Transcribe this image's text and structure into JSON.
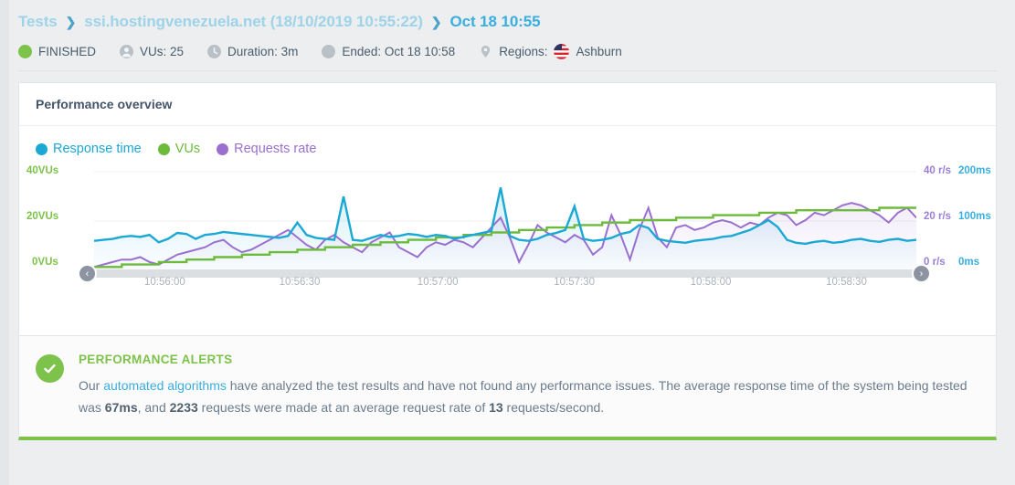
{
  "breadcrumb": {
    "root": "Tests",
    "separator": "❯",
    "test_name": "ssi.hostingvenezuela.net (18/10/2019 10:55:22)",
    "current": "Oct 18 10:55"
  },
  "meta": {
    "status": "FINISHED",
    "status_color": "#7dc24b",
    "vus": "VUs: 25",
    "duration": "Duration: 3m",
    "ended": "Ended: Oct 18 10:58",
    "regions_label": "Regions:",
    "region": "Ashburn",
    "icons": {
      "status": "circle-filled-icon",
      "vus": "user-icon",
      "duration": "clock-icon",
      "ended": "circle-icon",
      "regions": "map-pin-icon",
      "flag": "us-flag-icon"
    }
  },
  "overview": {
    "title": "Performance overview"
  },
  "chart_data": {
    "type": "line",
    "title": "Performance overview",
    "xlabel": "",
    "grid": true,
    "legend_position": "top-left",
    "x_ticks": [
      "10:56:00",
      "10:56:30",
      "10:57:00",
      "10:57:30",
      "10:58:00",
      "10:58:30"
    ],
    "x_tick_positions_pct": [
      8.6,
      25.0,
      41.8,
      58.4,
      75.0,
      91.5
    ],
    "axes": {
      "left": {
        "name": "VUs",
        "color": "#7dc24b",
        "ticks": [
          "0VUs",
          "20VUs",
          "40VUs"
        ],
        "range": [
          0,
          40
        ]
      },
      "right_inner": {
        "name": "Requests rate",
        "color": "#9b7fd4",
        "ticks": [
          "0 r/s",
          "20 r/s",
          "40 r/s"
        ],
        "range": [
          0,
          40
        ]
      },
      "right_outer": {
        "name": "Response time",
        "color": "#3aaede",
        "ticks": [
          "0ms",
          "100ms",
          "200ms"
        ],
        "range": [
          0,
          200
        ]
      }
    },
    "series": [
      {
        "name": "Response time",
        "color": "#1ba8d4",
        "unit": "ms",
        "axis": "right_outer",
        "filled": true,
        "values": [
          58,
          60,
          62,
          66,
          68,
          66,
          70,
          55,
          62,
          74,
          72,
          62,
          70,
          72,
          76,
          74,
          72,
          70,
          68,
          66,
          64,
          68,
          95,
          70,
          64,
          62,
          60,
          148,
          60,
          58,
          64,
          70,
          66,
          68,
          72,
          70,
          66,
          70,
          68,
          62,
          66,
          70,
          74,
          78,
          166,
          68,
          60,
          58,
          62,
          70,
          74,
          80,
          128,
          62,
          58,
          60,
          64,
          72,
          76,
          90,
          84,
          62,
          58,
          56,
          54,
          58,
          60,
          62,
          66,
          68,
          74,
          80,
          90,
          100,
          86,
          60,
          54,
          52,
          56,
          58,
          54,
          56,
          60,
          62,
          58,
          56,
          60,
          62,
          58,
          60
        ]
      },
      {
        "name": "VUs",
        "color": "#6cbb3c",
        "unit": "VUs",
        "axis": "left",
        "step": true,
        "values": [
          1,
          1,
          1,
          2,
          2,
          2,
          2,
          3,
          3,
          3,
          4,
          4,
          4,
          5,
          5,
          5,
          6,
          6,
          6,
          7,
          7,
          7,
          8,
          8,
          8,
          9,
          9,
          9,
          10,
          10,
          10,
          11,
          11,
          11,
          12,
          12,
          12,
          13,
          13,
          13,
          14,
          14,
          14,
          15,
          15,
          15,
          16,
          16,
          16,
          17,
          17,
          17,
          18,
          18,
          18,
          19,
          19,
          19,
          20,
          20,
          20,
          20,
          20,
          21,
          21,
          21,
          21,
          22,
          22,
          22,
          22,
          22,
          23,
          23,
          23,
          23,
          24,
          24,
          24,
          24,
          24,
          24,
          24,
          24,
          24,
          25,
          25,
          25,
          25,
          25
        ]
      },
      {
        "name": "Requests rate",
        "color": "#9b6fd0",
        "unit": "r/s",
        "axis": "right_inner",
        "values": [
          1,
          2,
          3,
          4,
          4,
          5,
          3,
          2,
          4,
          6,
          7,
          8,
          9,
          11,
          12,
          9,
          7,
          8,
          10,
          12,
          14,
          16,
          13,
          10,
          8,
          12,
          14,
          11,
          9,
          7,
          11,
          13,
          15,
          9,
          7,
          5,
          9,
          11,
          10,
          12,
          11,
          9,
          13,
          17,
          21,
          13,
          3,
          10,
          18,
          15,
          13,
          11,
          14,
          12,
          6,
          9,
          22,
          14,
          4,
          16,
          25,
          13,
          9,
          17,
          18,
          16,
          17,
          19,
          20,
          19,
          17,
          19,
          18,
          21,
          23,
          22,
          18,
          20,
          23,
          22,
          24,
          26,
          27,
          26,
          24,
          22,
          19,
          23,
          25,
          21
        ]
      }
    ]
  },
  "chart_nav": {
    "prev": "‹",
    "next": "›"
  },
  "alerts": {
    "icon": "check-circle-icon",
    "accent_color": "#7dc24b",
    "title": "PERFORMANCE ALERTS",
    "text_prefix": "Our ",
    "link": "automated algorithms",
    "text_mid": " have analyzed the test results and have not found any performance issues. The average response time of the system being tested was ",
    "avg_response": "67ms",
    "text_mid2": ", and ",
    "request_count": "2233",
    "text_mid3": " requests were made at an average request rate of ",
    "request_rate": "13",
    "text_suffix": " requests/second."
  }
}
